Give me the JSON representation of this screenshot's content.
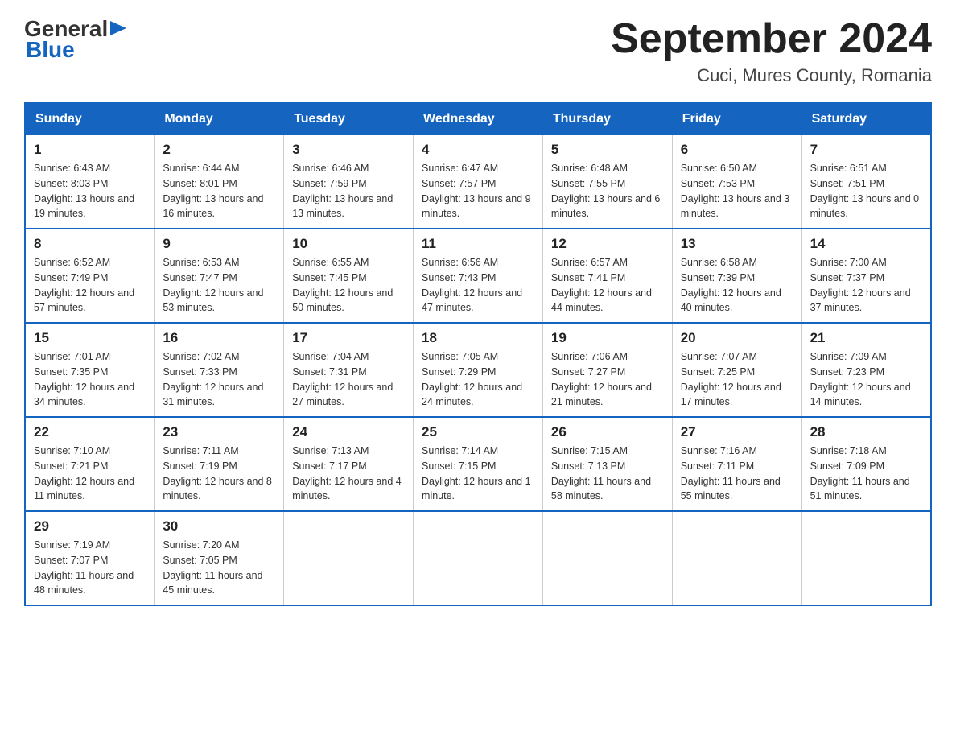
{
  "logo": {
    "text_general": "General",
    "text_blue": "Blue",
    "arrow_color": "#1565C0"
  },
  "header": {
    "title": "September 2024",
    "subtitle": "Cuci, Mures County, Romania"
  },
  "weekdays": [
    "Sunday",
    "Monday",
    "Tuesday",
    "Wednesday",
    "Thursday",
    "Friday",
    "Saturday"
  ],
  "weeks": [
    [
      {
        "day": "1",
        "sunrise": "6:43 AM",
        "sunset": "8:03 PM",
        "daylight": "13 hours and 19 minutes."
      },
      {
        "day": "2",
        "sunrise": "6:44 AM",
        "sunset": "8:01 PM",
        "daylight": "13 hours and 16 minutes."
      },
      {
        "day": "3",
        "sunrise": "6:46 AM",
        "sunset": "7:59 PM",
        "daylight": "13 hours and 13 minutes."
      },
      {
        "day": "4",
        "sunrise": "6:47 AM",
        "sunset": "7:57 PM",
        "daylight": "13 hours and 9 minutes."
      },
      {
        "day": "5",
        "sunrise": "6:48 AM",
        "sunset": "7:55 PM",
        "daylight": "13 hours and 6 minutes."
      },
      {
        "day": "6",
        "sunrise": "6:50 AM",
        "sunset": "7:53 PM",
        "daylight": "13 hours and 3 minutes."
      },
      {
        "day": "7",
        "sunrise": "6:51 AM",
        "sunset": "7:51 PM",
        "daylight": "13 hours and 0 minutes."
      }
    ],
    [
      {
        "day": "8",
        "sunrise": "6:52 AM",
        "sunset": "7:49 PM",
        "daylight": "12 hours and 57 minutes."
      },
      {
        "day": "9",
        "sunrise": "6:53 AM",
        "sunset": "7:47 PM",
        "daylight": "12 hours and 53 minutes."
      },
      {
        "day": "10",
        "sunrise": "6:55 AM",
        "sunset": "7:45 PM",
        "daylight": "12 hours and 50 minutes."
      },
      {
        "day": "11",
        "sunrise": "6:56 AM",
        "sunset": "7:43 PM",
        "daylight": "12 hours and 47 minutes."
      },
      {
        "day": "12",
        "sunrise": "6:57 AM",
        "sunset": "7:41 PM",
        "daylight": "12 hours and 44 minutes."
      },
      {
        "day": "13",
        "sunrise": "6:58 AM",
        "sunset": "7:39 PM",
        "daylight": "12 hours and 40 minutes."
      },
      {
        "day": "14",
        "sunrise": "7:00 AM",
        "sunset": "7:37 PM",
        "daylight": "12 hours and 37 minutes."
      }
    ],
    [
      {
        "day": "15",
        "sunrise": "7:01 AM",
        "sunset": "7:35 PM",
        "daylight": "12 hours and 34 minutes."
      },
      {
        "day": "16",
        "sunrise": "7:02 AM",
        "sunset": "7:33 PM",
        "daylight": "12 hours and 31 minutes."
      },
      {
        "day": "17",
        "sunrise": "7:04 AM",
        "sunset": "7:31 PM",
        "daylight": "12 hours and 27 minutes."
      },
      {
        "day": "18",
        "sunrise": "7:05 AM",
        "sunset": "7:29 PM",
        "daylight": "12 hours and 24 minutes."
      },
      {
        "day": "19",
        "sunrise": "7:06 AM",
        "sunset": "7:27 PM",
        "daylight": "12 hours and 21 minutes."
      },
      {
        "day": "20",
        "sunrise": "7:07 AM",
        "sunset": "7:25 PM",
        "daylight": "12 hours and 17 minutes."
      },
      {
        "day": "21",
        "sunrise": "7:09 AM",
        "sunset": "7:23 PM",
        "daylight": "12 hours and 14 minutes."
      }
    ],
    [
      {
        "day": "22",
        "sunrise": "7:10 AM",
        "sunset": "7:21 PM",
        "daylight": "12 hours and 11 minutes."
      },
      {
        "day": "23",
        "sunrise": "7:11 AM",
        "sunset": "7:19 PM",
        "daylight": "12 hours and 8 minutes."
      },
      {
        "day": "24",
        "sunrise": "7:13 AM",
        "sunset": "7:17 PM",
        "daylight": "12 hours and 4 minutes."
      },
      {
        "day": "25",
        "sunrise": "7:14 AM",
        "sunset": "7:15 PM",
        "daylight": "12 hours and 1 minute."
      },
      {
        "day": "26",
        "sunrise": "7:15 AM",
        "sunset": "7:13 PM",
        "daylight": "11 hours and 58 minutes."
      },
      {
        "day": "27",
        "sunrise": "7:16 AM",
        "sunset": "7:11 PM",
        "daylight": "11 hours and 55 minutes."
      },
      {
        "day": "28",
        "sunrise": "7:18 AM",
        "sunset": "7:09 PM",
        "daylight": "11 hours and 51 minutes."
      }
    ],
    [
      {
        "day": "29",
        "sunrise": "7:19 AM",
        "sunset": "7:07 PM",
        "daylight": "11 hours and 48 minutes."
      },
      {
        "day": "30",
        "sunrise": "7:20 AM",
        "sunset": "7:05 PM",
        "daylight": "11 hours and 45 minutes."
      },
      null,
      null,
      null,
      null,
      null
    ]
  ]
}
